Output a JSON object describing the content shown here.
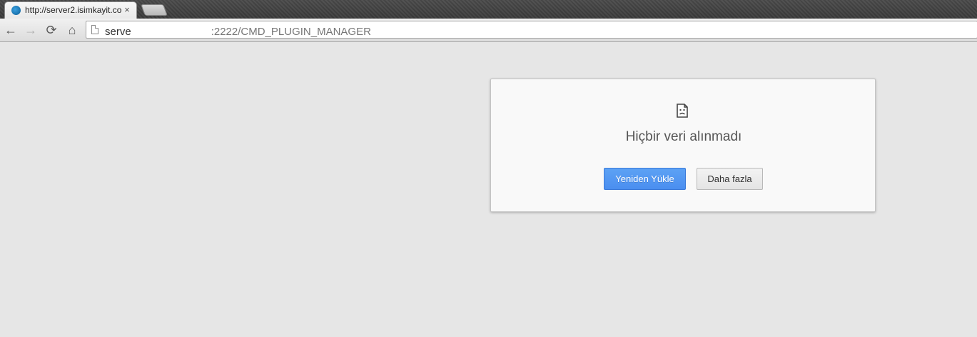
{
  "browser": {
    "tab_title": "http://server2.isimkayit.co",
    "tab_close": "×",
    "nav": {
      "back": "←",
      "forward": "→",
      "reload": "⟳",
      "home": "⌂"
    },
    "address": {
      "host_visible": "serve",
      "path": ":2222/CMD_PLUGIN_MANAGER"
    }
  },
  "error_page": {
    "icon": "sad-page-icon",
    "message": "Hiçbir veri alınmadı",
    "reload_button": "Yeniden Yükle",
    "more_button": "Daha fazla"
  },
  "colors": {
    "primary_button": "#4a8ef0",
    "page_background": "#e6e6e6"
  }
}
